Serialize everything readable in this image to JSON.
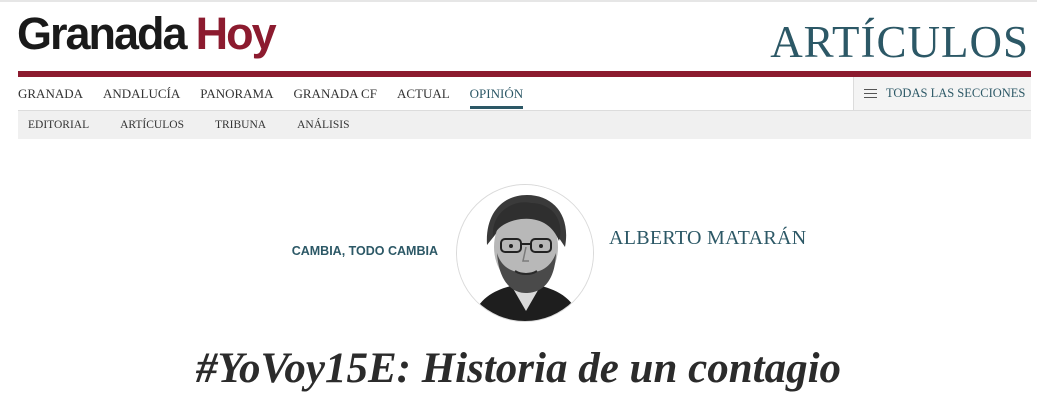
{
  "header": {
    "logo_part1": "Granada",
    "logo_part2": "Hoy",
    "section_title": "ARTÍCULOS",
    "brand_color": "#8c1b2f",
    "accent_color": "#2c5866"
  },
  "main_nav": {
    "items": [
      "GRANADA",
      "ANDALUCÍA",
      "PANORAMA",
      "GRANADA CF",
      "ACTUAL",
      "OPINIÓN"
    ],
    "active": "OPINIÓN",
    "sections_button": {
      "icon": "menu-icon",
      "label": "TODAS LAS SECCIONES"
    }
  },
  "sub_nav": {
    "items": [
      "EDITORIAL",
      "ARTÍCULOS",
      "TRIBUNA",
      "ANÁLISIS"
    ]
  },
  "article": {
    "column_name": "CAMBIA, TODO CAMBIA",
    "author": "ALBERTO MATARÁN",
    "headline": "#YoVoy15E: Historia de un contagio"
  }
}
